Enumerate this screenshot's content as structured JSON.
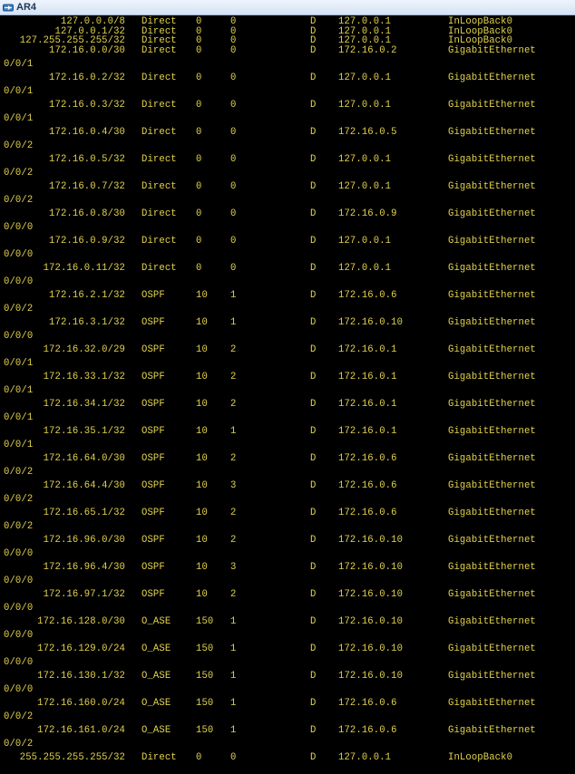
{
  "window": {
    "title": "AR4"
  },
  "colors": {
    "terminal_text": "#e3d34d",
    "terminal_bg": "#000000",
    "title_bg": "#dbe7f5"
  },
  "routes": [
    {
      "dest": "127.0.0.0/8",
      "proto": "Direct",
      "pre": "0",
      "cost": "0",
      "flags": "D",
      "nexthop": "127.0.0.1",
      "iface": "InLoopBack0",
      "wrap": ""
    },
    {
      "dest": "127.0.0.1/32",
      "proto": "Direct",
      "pre": "0",
      "cost": "0",
      "flags": "D",
      "nexthop": "127.0.0.1",
      "iface": "InLoopBack0",
      "wrap": ""
    },
    {
      "dest": "127.255.255.255/32",
      "proto": "Direct",
      "pre": "0",
      "cost": "0",
      "flags": "D",
      "nexthop": "127.0.0.1",
      "iface": "InLoopBack0",
      "wrap": ""
    },
    {
      "dest": "172.16.0.0/30",
      "proto": "Direct",
      "pre": "0",
      "cost": "0",
      "flags": "D",
      "nexthop": "172.16.0.2",
      "iface": "GigabitEthernet",
      "wrap": "0/0/1"
    },
    {
      "dest": "172.16.0.2/32",
      "proto": "Direct",
      "pre": "0",
      "cost": "0",
      "flags": "D",
      "nexthop": "127.0.0.1",
      "iface": "GigabitEthernet",
      "wrap": "0/0/1"
    },
    {
      "dest": "172.16.0.3/32",
      "proto": "Direct",
      "pre": "0",
      "cost": "0",
      "flags": "D",
      "nexthop": "127.0.0.1",
      "iface": "GigabitEthernet",
      "wrap": "0/0/1"
    },
    {
      "dest": "172.16.0.4/30",
      "proto": "Direct",
      "pre": "0",
      "cost": "0",
      "flags": "D",
      "nexthop": "172.16.0.5",
      "iface": "GigabitEthernet",
      "wrap": "0/0/2"
    },
    {
      "dest": "172.16.0.5/32",
      "proto": "Direct",
      "pre": "0",
      "cost": "0",
      "flags": "D",
      "nexthop": "127.0.0.1",
      "iface": "GigabitEthernet",
      "wrap": "0/0/2"
    },
    {
      "dest": "172.16.0.7/32",
      "proto": "Direct",
      "pre": "0",
      "cost": "0",
      "flags": "D",
      "nexthop": "127.0.0.1",
      "iface": "GigabitEthernet",
      "wrap": "0/0/2"
    },
    {
      "dest": "172.16.0.8/30",
      "proto": "Direct",
      "pre": "0",
      "cost": "0",
      "flags": "D",
      "nexthop": "172.16.0.9",
      "iface": "GigabitEthernet",
      "wrap": "0/0/0"
    },
    {
      "dest": "172.16.0.9/32",
      "proto": "Direct",
      "pre": "0",
      "cost": "0",
      "flags": "D",
      "nexthop": "127.0.0.1",
      "iface": "GigabitEthernet",
      "wrap": "0/0/0"
    },
    {
      "dest": "172.16.0.11/32",
      "proto": "Direct",
      "pre": "0",
      "cost": "0",
      "flags": "D",
      "nexthop": "127.0.0.1",
      "iface": "GigabitEthernet",
      "wrap": "0/0/0"
    },
    {
      "dest": "172.16.2.1/32",
      "proto": "OSPF",
      "pre": "10",
      "cost": "1",
      "flags": "D",
      "nexthop": "172.16.0.6",
      "iface": "GigabitEthernet",
      "wrap": "0/0/2"
    },
    {
      "dest": "172.16.3.1/32",
      "proto": "OSPF",
      "pre": "10",
      "cost": "1",
      "flags": "D",
      "nexthop": "172.16.0.10",
      "iface": "GigabitEthernet",
      "wrap": "0/0/0"
    },
    {
      "dest": "172.16.32.0/29",
      "proto": "OSPF",
      "pre": "10",
      "cost": "2",
      "flags": "D",
      "nexthop": "172.16.0.1",
      "iface": "GigabitEthernet",
      "wrap": "0/0/1"
    },
    {
      "dest": "172.16.33.1/32",
      "proto": "OSPF",
      "pre": "10",
      "cost": "2",
      "flags": "D",
      "nexthop": "172.16.0.1",
      "iface": "GigabitEthernet",
      "wrap": "0/0/1"
    },
    {
      "dest": "172.16.34.1/32",
      "proto": "OSPF",
      "pre": "10",
      "cost": "2",
      "flags": "D",
      "nexthop": "172.16.0.1",
      "iface": "GigabitEthernet",
      "wrap": "0/0/1"
    },
    {
      "dest": "172.16.35.1/32",
      "proto": "OSPF",
      "pre": "10",
      "cost": "1",
      "flags": "D",
      "nexthop": "172.16.0.1",
      "iface": "GigabitEthernet",
      "wrap": "0/0/1"
    },
    {
      "dest": "172.16.64.0/30",
      "proto": "OSPF",
      "pre": "10",
      "cost": "2",
      "flags": "D",
      "nexthop": "172.16.0.6",
      "iface": "GigabitEthernet",
      "wrap": "0/0/2"
    },
    {
      "dest": "172.16.64.4/30",
      "proto": "OSPF",
      "pre": "10",
      "cost": "3",
      "flags": "D",
      "nexthop": "172.16.0.6",
      "iface": "GigabitEthernet",
      "wrap": "0/0/2"
    },
    {
      "dest": "172.16.65.1/32",
      "proto": "OSPF",
      "pre": "10",
      "cost": "2",
      "flags": "D",
      "nexthop": "172.16.0.6",
      "iface": "GigabitEthernet",
      "wrap": "0/0/2"
    },
    {
      "dest": "172.16.96.0/30",
      "proto": "OSPF",
      "pre": "10",
      "cost": "2",
      "flags": "D",
      "nexthop": "172.16.0.10",
      "iface": "GigabitEthernet",
      "wrap": "0/0/0"
    },
    {
      "dest": "172.16.96.4/30",
      "proto": "OSPF",
      "pre": "10",
      "cost": "3",
      "flags": "D",
      "nexthop": "172.16.0.10",
      "iface": "GigabitEthernet",
      "wrap": "0/0/0"
    },
    {
      "dest": "172.16.97.1/32",
      "proto": "OSPF",
      "pre": "10",
      "cost": "2",
      "flags": "D",
      "nexthop": "172.16.0.10",
      "iface": "GigabitEthernet",
      "wrap": "0/0/0"
    },
    {
      "dest": "172.16.128.0/30",
      "proto": "O_ASE",
      "pre": "150",
      "cost": "1",
      "flags": "D",
      "nexthop": "172.16.0.10",
      "iface": "GigabitEthernet",
      "wrap": "0/0/0"
    },
    {
      "dest": "172.16.129.0/24",
      "proto": "O_ASE",
      "pre": "150",
      "cost": "1",
      "flags": "D",
      "nexthop": "172.16.0.10",
      "iface": "GigabitEthernet",
      "wrap": "0/0/0"
    },
    {
      "dest": "172.16.130.1/32",
      "proto": "O_ASE",
      "pre": "150",
      "cost": "1",
      "flags": "D",
      "nexthop": "172.16.0.10",
      "iface": "GigabitEthernet",
      "wrap": "0/0/0"
    },
    {
      "dest": "172.16.160.0/24",
      "proto": "O_ASE",
      "pre": "150",
      "cost": "1",
      "flags": "D",
      "nexthop": "172.16.0.6",
      "iface": "GigabitEthernet",
      "wrap": "0/0/2"
    },
    {
      "dest": "172.16.161.0/24",
      "proto": "O_ASE",
      "pre": "150",
      "cost": "1",
      "flags": "D",
      "nexthop": "172.16.0.6",
      "iface": "GigabitEthernet",
      "wrap": "0/0/2"
    },
    {
      "dest": "255.255.255.255/32",
      "proto": "Direct",
      "pre": "0",
      "cost": "0",
      "flags": "D",
      "nexthop": "127.0.0.1",
      "iface": "InLoopBack0",
      "wrap": ""
    }
  ]
}
